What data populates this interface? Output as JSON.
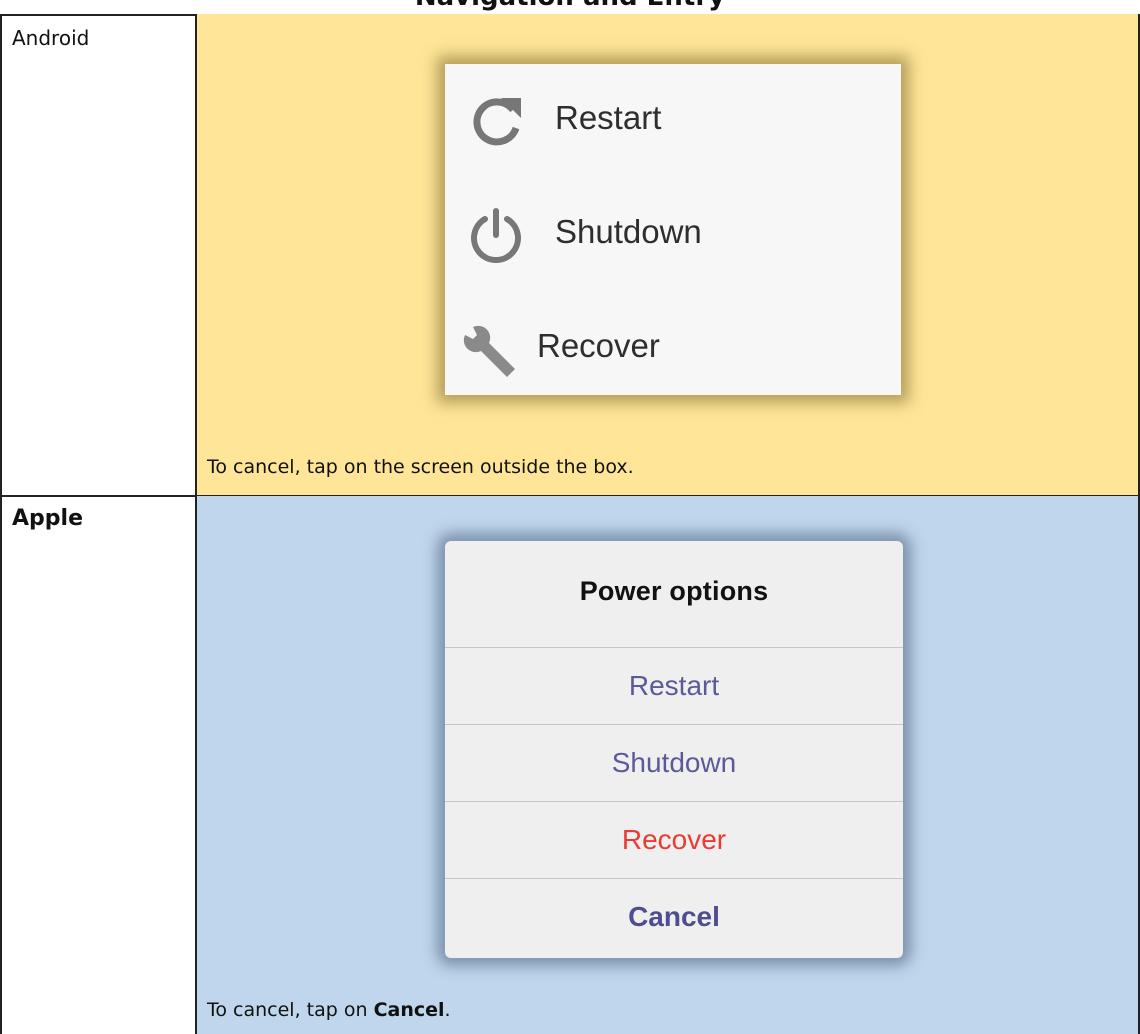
{
  "header": {
    "title": "Navigation and Entry"
  },
  "android": {
    "label": "Android",
    "menu": [
      {
        "label": "Restart",
        "icon": "restart-icon"
      },
      {
        "label": "Shutdown",
        "icon": "power-icon"
      },
      {
        "label": "Recover",
        "icon": "wrench-icon"
      }
    ],
    "note": "To cancel, tap on the screen outside the box."
  },
  "apple": {
    "label": "Apple",
    "dialog_title": "Power options",
    "buttons": [
      {
        "label": "Restart"
      },
      {
        "label": "Shutdown"
      },
      {
        "label": "Recover"
      },
      {
        "label": "Cancel"
      }
    ],
    "note_prefix": "To cancel, tap on ",
    "note_bold": "Cancel",
    "note_suffix": "."
  },
  "colors": {
    "android_bg": "#fee598",
    "apple_bg": "#bfd6ec",
    "apple_action": "#5b5a99",
    "apple_destructive": "#ec3a33"
  }
}
